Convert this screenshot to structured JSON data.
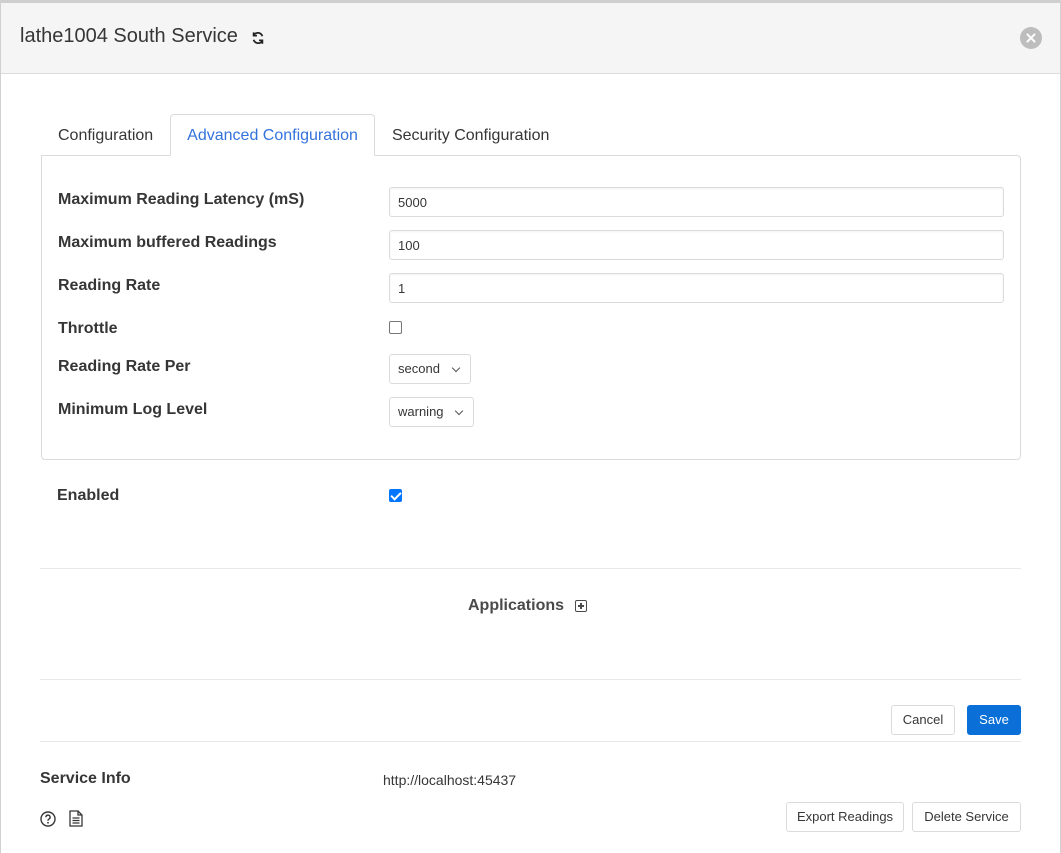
{
  "header": {
    "title": "lathe1004 South Service",
    "refresh_icon": "refresh-icon",
    "close_icon": "close-icon"
  },
  "tabs": [
    {
      "label": "Configuration",
      "active": false
    },
    {
      "label": "Advanced Configuration",
      "active": true
    },
    {
      "label": "Security Configuration",
      "active": false
    }
  ],
  "advanced": {
    "max_latency_label": "Maximum Reading Latency (mS)",
    "max_latency_value": "5000",
    "max_buffered_label": "Maximum buffered Readings",
    "max_buffered_value": "100",
    "reading_rate_label": "Reading Rate",
    "reading_rate_value": "1",
    "throttle_label": "Throttle",
    "throttle_checked": false,
    "rate_per_label": "Reading Rate Per",
    "rate_per_value": "second",
    "log_level_label": "Minimum Log Level",
    "log_level_value": "warning"
  },
  "enabled": {
    "label": "Enabled",
    "checked": true
  },
  "applications": {
    "label": "Applications",
    "add_icon": "plus-square-icon"
  },
  "actions": {
    "cancel_label": "Cancel",
    "save_label": "Save"
  },
  "service_info": {
    "label": "Service Info",
    "url": "http://localhost:45437",
    "export_label": "Export Readings",
    "delete_label": "Delete Service",
    "help_icon": "help-circle-icon",
    "doc_icon": "document-icon"
  },
  "colors": {
    "accent": "#3273dc",
    "primary_button": "#0a6fd6",
    "checkbox_checked": "#0075ff"
  }
}
